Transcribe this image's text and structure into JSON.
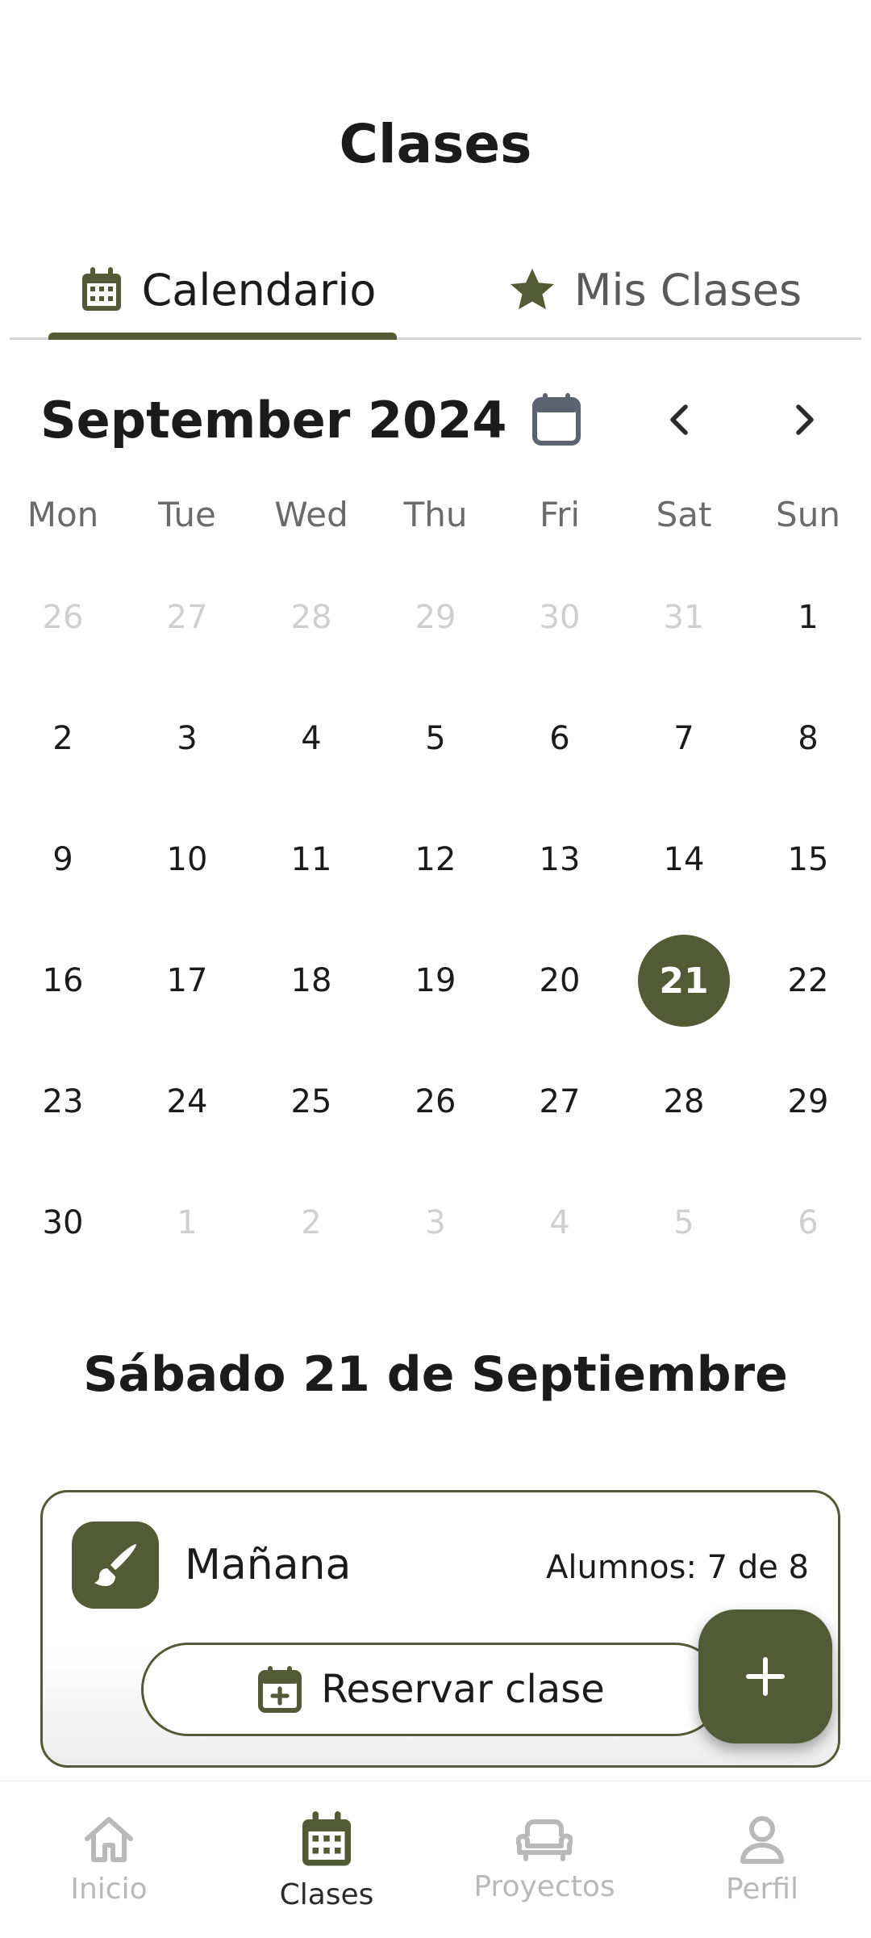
{
  "header": {
    "title": "Clases"
  },
  "tabs": [
    {
      "label": "Calendario",
      "icon": "calendar-icon",
      "active": true
    },
    {
      "label": "Mis Clases",
      "icon": "star-icon",
      "active": false
    }
  ],
  "calendar": {
    "month_label": "September 2024",
    "weekdays": [
      "Mon",
      "Tue",
      "Wed",
      "Thu",
      "Fri",
      "Sat",
      "Sun"
    ],
    "days": [
      {
        "n": "26",
        "muted": true
      },
      {
        "n": "27",
        "muted": true
      },
      {
        "n": "28",
        "muted": true
      },
      {
        "n": "29",
        "muted": true
      },
      {
        "n": "30",
        "muted": true
      },
      {
        "n": "31",
        "muted": true
      },
      {
        "n": "1"
      },
      {
        "n": "2"
      },
      {
        "n": "3"
      },
      {
        "n": "4"
      },
      {
        "n": "5"
      },
      {
        "n": "6"
      },
      {
        "n": "7"
      },
      {
        "n": "8"
      },
      {
        "n": "9"
      },
      {
        "n": "10"
      },
      {
        "n": "11"
      },
      {
        "n": "12"
      },
      {
        "n": "13"
      },
      {
        "n": "14"
      },
      {
        "n": "15"
      },
      {
        "n": "16"
      },
      {
        "n": "17"
      },
      {
        "n": "18"
      },
      {
        "n": "19"
      },
      {
        "n": "20"
      },
      {
        "n": "21",
        "selected": true
      },
      {
        "n": "22"
      },
      {
        "n": "23"
      },
      {
        "n": "24"
      },
      {
        "n": "25"
      },
      {
        "n": "26"
      },
      {
        "n": "27"
      },
      {
        "n": "28"
      },
      {
        "n": "29"
      },
      {
        "n": "30"
      },
      {
        "n": "1",
        "muted": true
      },
      {
        "n": "2",
        "muted": true
      },
      {
        "n": "3",
        "muted": true
      },
      {
        "n": "4",
        "muted": true
      },
      {
        "n": "5",
        "muted": true
      },
      {
        "n": "6",
        "muted": true
      }
    ]
  },
  "selected_date": {
    "label": "Sábado 21 de Septiembre"
  },
  "class_card": {
    "name": "Mañana",
    "students": "Alumnos: 7 de 8",
    "reserve_label": "Reservar clase"
  },
  "bottom_nav": [
    {
      "label": "Inicio",
      "icon": "home-icon",
      "active": false
    },
    {
      "label": "Clases",
      "icon": "calendar-icon",
      "active": true
    },
    {
      "label": "Proyectos",
      "icon": "sofa-icon",
      "active": false
    },
    {
      "label": "Perfil",
      "icon": "person-icon",
      "active": false
    }
  ],
  "colors": {
    "accent": "#525a36",
    "muted_text": "#cfcfcf",
    "inactive_nav": "#b9b9b9"
  }
}
